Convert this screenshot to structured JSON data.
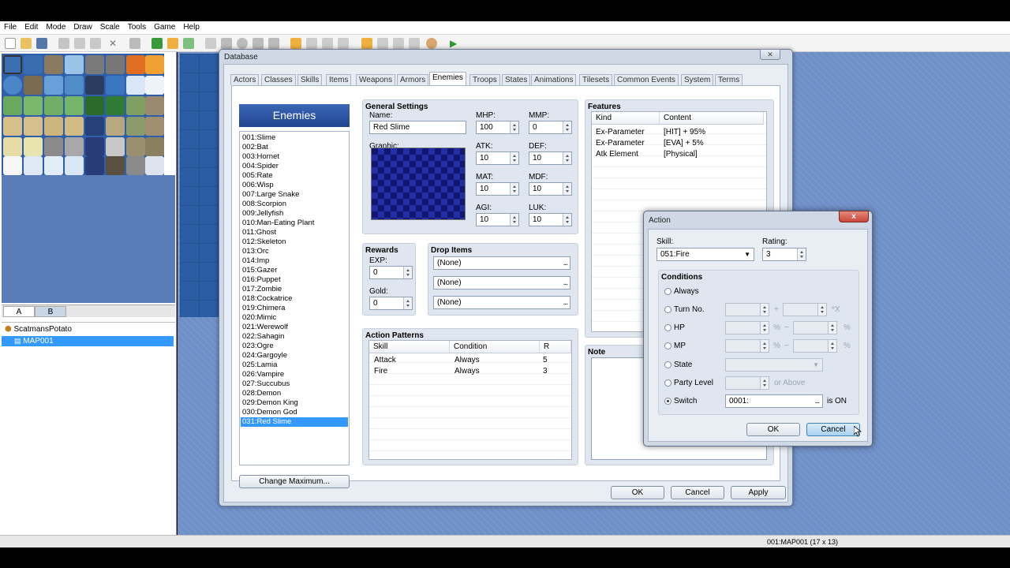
{
  "menu": [
    "File",
    "Edit",
    "Mode",
    "Draw",
    "Scale",
    "Tools",
    "Game",
    "Help"
  ],
  "tileset_tabs": [
    "A",
    "B"
  ],
  "map_tree": {
    "project": "ScatmansPotato",
    "map": "MAP001"
  },
  "status": {
    "map_info": "001:MAP001 (17 x 13)"
  },
  "database": {
    "title": "Database",
    "close": "✕",
    "tabs": [
      "Actors",
      "Classes",
      "Skills",
      "Items",
      "Weapons",
      "Armors",
      "Enemies",
      "Troops",
      "States",
      "Animations",
      "Tilesets",
      "Common Events",
      "System",
      "Terms"
    ],
    "active_tab": "Enemies",
    "list_header": "Enemies",
    "enemies": [
      "001:Slime",
      "002:Bat",
      "003:Hornet",
      "004:Spider",
      "005:Rate",
      "006:Wisp",
      "007:Large Snake",
      "008:Scorpion",
      "009:Jellyfish",
      "010:Man-Eating Plant",
      "011:Ghost",
      "012:Skeleton",
      "013:Orc",
      "014:Imp",
      "015:Gazer",
      "016:Puppet",
      "017:Zombie",
      "018:Cockatrice",
      "019:Chimera",
      "020:Mimic",
      "021:Werewolf",
      "022:Sahagin",
      "023:Ogre",
      "024:Gargoyle",
      "025:Lamia",
      "026:Vampire",
      "027:Succubus",
      "028:Demon",
      "029:Demon King",
      "030:Demon God",
      "031:Red Slime"
    ],
    "change_max": "Change Maximum...",
    "general": {
      "title": "General Settings",
      "name_label": "Name:",
      "name": "Red Slime",
      "graphic_label": "Graphic:",
      "mhp_label": "MHP:",
      "mhp": "100",
      "mmp_label": "MMP:",
      "mmp": "0",
      "atk_label": "ATK:",
      "atk": "10",
      "def_label": "DEF:",
      "def": "10",
      "mat_label": "MAT:",
      "mat": "10",
      "mdf_label": "MDF:",
      "mdf": "10",
      "agi_label": "AGI:",
      "agi": "10",
      "luk_label": "LUK:",
      "luk": "10"
    },
    "rewards": {
      "title": "Rewards",
      "exp_label": "EXP:",
      "exp": "0",
      "gold_label": "Gold:",
      "gold": "0"
    },
    "drops": {
      "title": "Drop Items",
      "items": [
        "(None)",
        "(None)",
        "(None)"
      ],
      "dots": "..."
    },
    "action_patterns": {
      "title": "Action Patterns",
      "headers": [
        "Skill",
        "Condition",
        "R"
      ],
      "rows": [
        {
          "skill": "Attack",
          "condition": "Always",
          "r": "5"
        },
        {
          "skill": "Fire",
          "condition": "Always",
          "r": "3"
        }
      ]
    },
    "features": {
      "title": "Features",
      "headers": [
        "Kind",
        "Content"
      ],
      "rows": [
        {
          "kind": "Ex-Parameter",
          "content": "[HIT] + 95%"
        },
        {
          "kind": "Ex-Parameter",
          "content": "[EVA] + 5%"
        },
        {
          "kind": "Atk Element",
          "content": "[Physical]"
        }
      ]
    },
    "note": {
      "title": "Note"
    },
    "buttons": {
      "ok": "OK",
      "cancel": "Cancel",
      "apply": "Apply"
    }
  },
  "action": {
    "title": "Action",
    "close": "x",
    "skill_label": "Skill:",
    "skill": "051:Fire",
    "rating_label": "Rating:",
    "rating": "3",
    "conditions_title": "Conditions",
    "cond": {
      "always": "Always",
      "turn": "Turn No.",
      "plus": "+",
      "x": "*X",
      "hp": "HP",
      "mp": "MP",
      "pct": "%",
      "tilde": "~",
      "state": "State",
      "party": "Party Level",
      "or_above": "or Above",
      "switch": "Switch",
      "switch_value": "0001:",
      "is_on": "is ON"
    },
    "buttons": {
      "ok": "OK",
      "cancel": "Cancel"
    }
  }
}
